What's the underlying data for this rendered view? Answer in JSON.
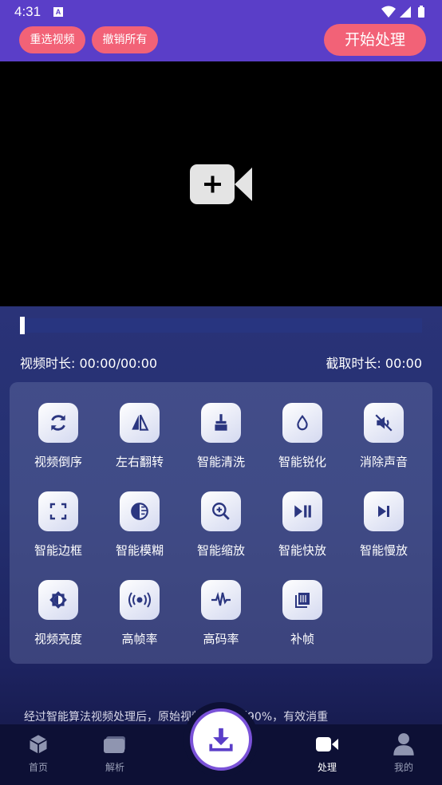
{
  "status_bar": {
    "time": "4:31",
    "notif_badge": "A"
  },
  "toolbar": {
    "reselect_label": "重选视频",
    "undo_all_label": "撤销所有",
    "start_label": "开始处理"
  },
  "player": {
    "duration_label": "视频时长: 00:00/00:00",
    "clip_label": "截取时长: 00:00"
  },
  "tools": [
    {
      "label": "视频倒序",
      "icon": "refresh-icon"
    },
    {
      "label": "左右翻转",
      "icon": "flip-icon"
    },
    {
      "label": "智能清洗",
      "icon": "broom-icon"
    },
    {
      "label": "智能锐化",
      "icon": "drop-icon"
    },
    {
      "label": "消除声音",
      "icon": "mute-icon"
    },
    {
      "label": "智能边框",
      "icon": "frame-icon"
    },
    {
      "label": "智能模糊",
      "icon": "blur-icon"
    },
    {
      "label": "智能缩放",
      "icon": "zoom-icon"
    },
    {
      "label": "智能快放",
      "icon": "fast-play-icon"
    },
    {
      "label": "智能慢放",
      "icon": "slow-play-icon"
    },
    {
      "label": "视频亮度",
      "icon": "brightness-icon"
    },
    {
      "label": "高帧率",
      "icon": "broadcast-icon"
    },
    {
      "label": "高码率",
      "icon": "pulse-icon"
    },
    {
      "label": "补帧",
      "icon": "film-icon"
    }
  ],
  "note": "经过智能算法视频处理后，原始视频已去重到90%，有效消重",
  "nav": {
    "home": "首页",
    "parse": "解析",
    "process": "处理",
    "mine": "我的"
  },
  "colors": {
    "accent": "#5a3ec8",
    "pill": "#f26277",
    "panel": "#243070"
  }
}
